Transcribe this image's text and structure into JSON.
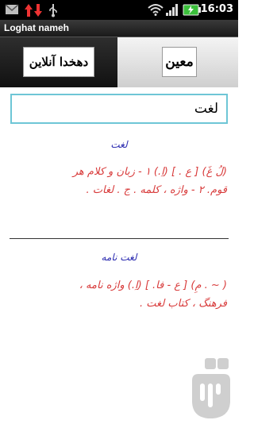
{
  "status_bar": {
    "time": "16:03",
    "left_icons": [
      "mail-icon",
      "data-transfer-icon",
      "usb-icon"
    ],
    "right_icons": [
      "wifi-icon",
      "signal-icon",
      "battery-icon"
    ]
  },
  "app": {
    "title": "Loghat nameh"
  },
  "tabs": [
    {
      "label": "دهخدا آنلاین"
    },
    {
      "label": "معین"
    }
  ],
  "search": {
    "value": "لغت"
  },
  "entries": [
    {
      "title": "لغت",
      "lines": [
        "(لُ غَ) [ ع . ] (اِ.) ۱ - زبان و کلام هر",
        "قوم. ۲ - واژه ، کلمه . ج . لغات ."
      ]
    },
    {
      "title": "لغت نامه",
      "lines": [
        "( ~ . مِ) [ ع - فا. ] (اِ.) واژه نامه ،",
        "فرهنگ ، کتاب لغت ."
      ]
    }
  ],
  "colors": {
    "accent_border": "#6ec6d6",
    "entry_title": "#2b2bb0",
    "entry_body": "#d83a3a"
  }
}
